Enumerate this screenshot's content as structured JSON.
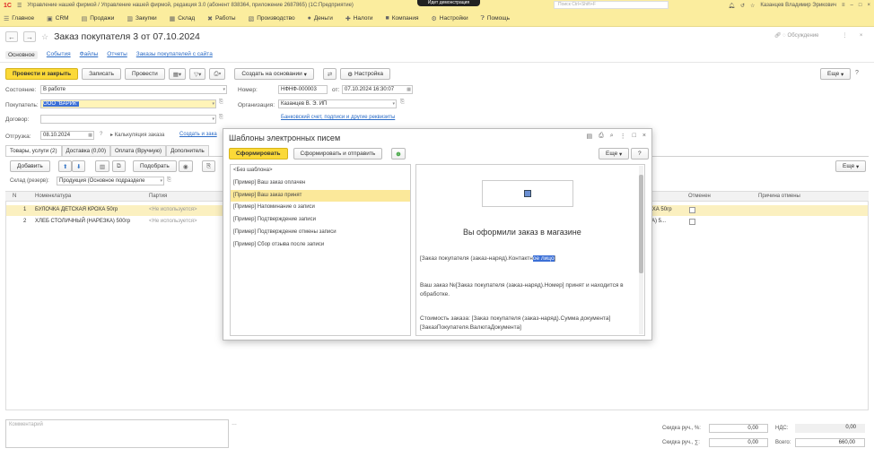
{
  "titlebar": {
    "app_text": "Управление нашей фирмой / Управление нашей фирмой, редакция 3.0 (абонент 838364, приложение 2687865) (1С:Предприятие)",
    "demo_badge": "Идет демонстрация",
    "search_placeholder": "Поиск Ctrl+Shift+F",
    "user": "Казанцев Владимир Эрикович"
  },
  "menu": [
    "Главное",
    "CRM",
    "Продажи",
    "Закупки",
    "Склад",
    "Работы",
    "Производство",
    "Деньги",
    "Налоги",
    "Компания",
    "Настройки",
    "Помощь"
  ],
  "doc": {
    "title": "Заказ покупателя 3 от 07.10.2024",
    "discuss": "Обсуждение"
  },
  "subnav": [
    "Основное",
    "События",
    "Файлы",
    "Отчеты",
    "Заказы покупателей с сайта"
  ],
  "toolbar": {
    "post_close": "Провести и закрыть",
    "save": "Записать",
    "post": "Провести",
    "create_based": "Создать на основании",
    "settings": "Настройка",
    "more": "Еще"
  },
  "form": {
    "state_label": "Состояние:",
    "state_value": "В работе",
    "number_label": "Номер:",
    "number_value": "НФНФ-000003",
    "from_label": "от:",
    "date_value": "07.10.2024 16:30:07",
    "buyer_label": "Покупатель:",
    "buyer_value": "ООО \"ВАРИК\"",
    "org_label": "Организация:",
    "org_value": "Казанцев В. Э. ИП",
    "contract_label": "Договор:",
    "bank_link": "Банковский счет, подписи и другие реквизиты",
    "shipment_label": "Отгрузка:",
    "shipment_value": "08.10.2024",
    "calc_label": "Калькуляция заказа",
    "calc_link": "Создать и зака"
  },
  "tabs": [
    "Товары, услуги (2)",
    "Доставка (0,00)",
    "Оплата (Вручную)",
    "Дополнитель"
  ],
  "table_toolbar": {
    "add": "Добавить",
    "pick": "Подобрать",
    "more": "Еще",
    "warehouse_label": "Склад (резерв):",
    "warehouse_value": "Продукция (Основное подразделе"
  },
  "table": {
    "columns": [
      "N",
      "Номенклатура",
      "Партия",
      "Отменен",
      "Причина отмены"
    ],
    "rows": [
      {
        "n": "1",
        "name": "БУЛОЧКА ДЕТСКАЯ КРОХА 50гр",
        "batch": "<Не используется>",
        "right": "КРОХА 50гр"
      },
      {
        "n": "2",
        "name": "ХЛЕБ СТОЛИЧНЫЙ (НАРЕЗКА) 500гр",
        "batch": "<Не используется>",
        "right": "ЕЗКА) 5..."
      }
    ]
  },
  "dialog": {
    "title": "Шаблоны электронных писем",
    "generate": "Сформировать",
    "generate_send": "Сформировать и отправить",
    "more": "Еще",
    "help": "?",
    "templates": [
      "<Без шаблона>",
      "[Пример] Ваш заказ оплачен",
      "[Пример] Ваш заказ принят",
      "[Пример] Напоминание о записи",
      "[Пример] Подтверждение записи",
      "[Пример] Подтверждение отмены записи",
      "[Пример] Сбор отзыва после записи"
    ],
    "selected_index": 2,
    "preview": {
      "heading": "Вы оформили заказ в магазине",
      "line1_a": "[Заказ покупателя (заказ-наряд).Контактн",
      "line1_hl": "ое лицо",
      "line1_b": "]",
      "line2": "Ваш заказ №[Заказ покупателя (заказ-наряд).Номер] принят и находится в обработке.",
      "line3": "Стоимость заказа: [Заказ покупателя (заказ-наряд).Сумма документа] [ЗаказПокупателя.ВалютаДокумента]"
    }
  },
  "footer": {
    "comment_placeholder": "Комментарий",
    "discount_pct_label": "Скидка руч., %:",
    "discount_pct_value": "0,00",
    "discount_sum_label": "Скидка руч., ∑:",
    "discount_sum_value": "0,00",
    "vat_label": "НДС:",
    "vat_value": "0,00",
    "total_label": "Всего:",
    "total_value": "660,00"
  }
}
